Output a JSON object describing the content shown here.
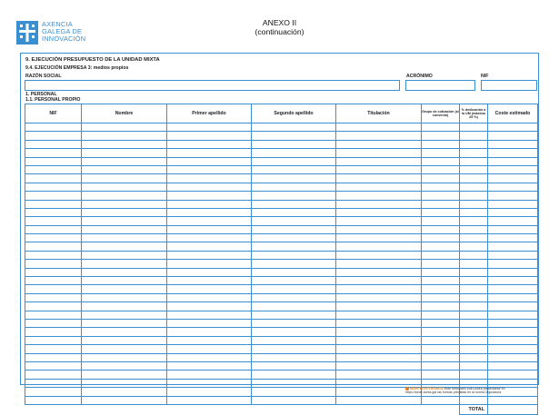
{
  "header": {
    "logo_lines": [
      "AXENCIA",
      "GALEGA DE",
      "INNOVACIÓN"
    ],
    "annex_title": "ANEXO II",
    "annex_subtitle": "(continuación)"
  },
  "section": {
    "title": "9. EJECUCIÓN PRESUPUESTO DE LA UNIDAD MIXTA",
    "subtitle": "9.4. EJECUCIÓN EMPRESA 3: medios propios",
    "razon_social_label": "RAZÓN SOCIAL",
    "acronimo_label": "ACRÓNIMO",
    "nif_label": "NIF",
    "personal_label": "1. PERSONAL",
    "personal_propio_label": "1.1. PERSONAL PROPIO"
  },
  "fields": {
    "razon_social": "",
    "acronimo": "",
    "nif": ""
  },
  "table": {
    "columns": [
      {
        "label": "NIF"
      },
      {
        "label": "Nombre"
      },
      {
        "label": "Primer apellido"
      },
      {
        "label": "Segundo apellido"
      },
      {
        "label": "Titulación"
      },
      {
        "label": "Grupo de cotización (s/ convenio)"
      },
      {
        "label": "% dedicación a la UM (máximo 25 %)"
      },
      {
        "label": "Coste estimado"
      }
    ],
    "total_label": "TOTAL"
  },
  "footer": {
    "sede": "SEDE ELECTRÓNICA",
    "line1": "Este formulario solo podrá presentarse en",
    "line2": "https://sede.xunta.gal  las formas previstas en la norma reguladora"
  },
  "colors": {
    "line": "#3a8fd0",
    "logo": "#3a8fd0",
    "sede_accent": "#e37b1c"
  }
}
